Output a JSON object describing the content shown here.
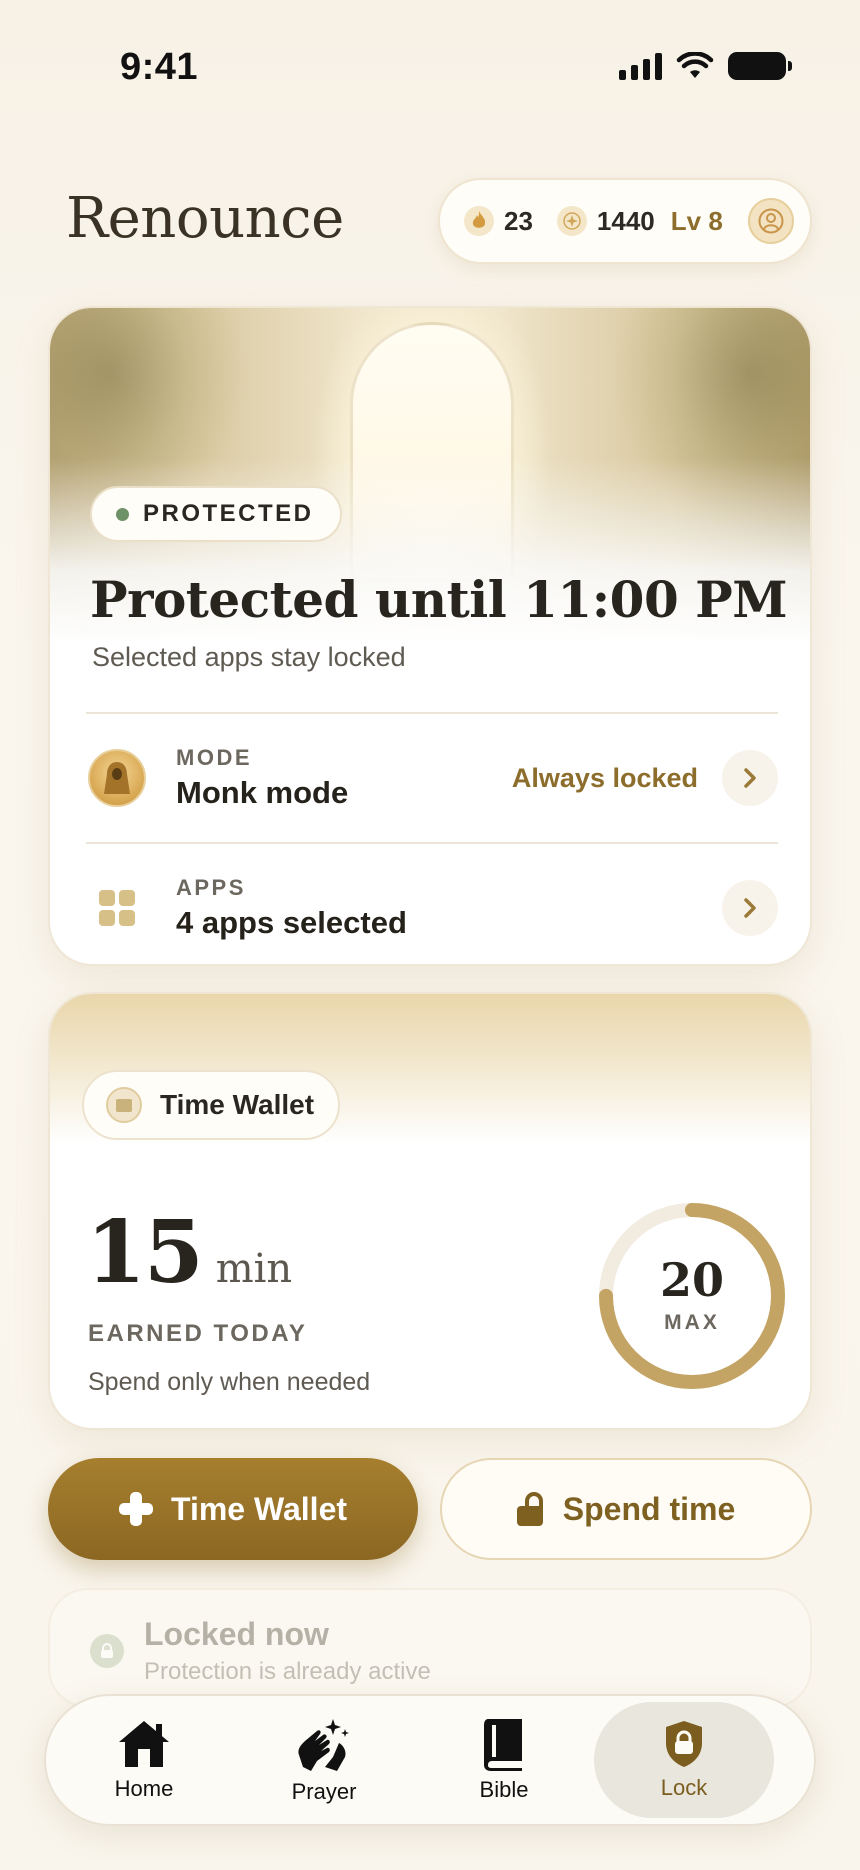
{
  "status_bar": {
    "time": "9:41"
  },
  "header": {
    "logo": "Renounce",
    "streak": "23",
    "points": "1440",
    "level": "Lv 8"
  },
  "protection": {
    "badge": "PROTECTED",
    "title": "Protected until 11:00 PM",
    "subtitle": "Selected apps stay locked",
    "mode": {
      "label": "MODE",
      "value": "Monk mode",
      "status": "Always locked"
    },
    "apps": {
      "label": "APPS",
      "value": "4 apps selected"
    }
  },
  "wallet": {
    "chip_label": "Time Wallet",
    "earned_value": "15",
    "earned_unit": "min",
    "earned_label": "EARNED TODAY",
    "subtitle": "Spend only when needed",
    "max_value": "20",
    "max_label": "MAX",
    "progress_fraction": 0.75
  },
  "actions": {
    "primary": "Time Wallet",
    "secondary": "Spend time"
  },
  "locked_now": {
    "title": "Locked now",
    "subtitle": "Protection is already active"
  },
  "tabs": [
    {
      "label": "Home",
      "icon": "home-icon"
    },
    {
      "label": "Prayer",
      "icon": "praying-hands-icon"
    },
    {
      "label": "Bible",
      "icon": "book-icon"
    },
    {
      "label": "Lock",
      "icon": "shield-lock-icon",
      "active": true
    }
  ],
  "colors": {
    "accent": "#8c6d2c",
    "primary_button": "#9a7428",
    "status_dot": "#6e9168",
    "ring": "#c4a464"
  }
}
